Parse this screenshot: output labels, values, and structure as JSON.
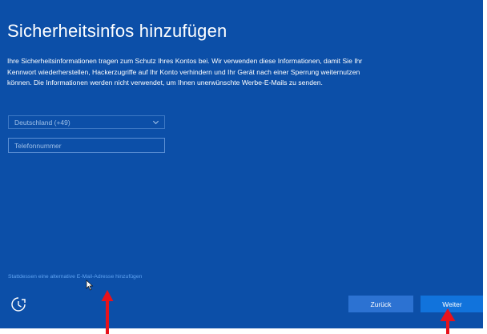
{
  "page": {
    "title": "Sicherheitsinfos hinzufügen",
    "description": "Ihre Sicherheitsinformationen tragen zum Schutz Ihres Kontos bei. Wir verwenden diese Informationen, damit Sie Ihr Kennwort wiederherstellen, Hackerzugriffe auf Ihr Konto verhindern und Ihr Gerät nach einer Sperrung weiternutzen können. Die Informationen werden nicht verwendet, um Ihnen unerwünschte Werbe-E-Mails zu senden."
  },
  "form": {
    "country_select": {
      "value": "Deutschland (+49)",
      "icon": "chevron-down-icon"
    },
    "phone_field": {
      "value": "",
      "placeholder": "Telefonnummer"
    },
    "alt_email_link": "Stattdessen eine alternative E-Mail-Adresse hinzufügen"
  },
  "footer": {
    "accessibility_icon": "ease-of-access-icon",
    "back_label": "Zurück",
    "next_label": "Weiter"
  },
  "annotations": {
    "arrow_color": "#e8121b",
    "arrow_icon": "red-arrow-up-icon",
    "cursor_icon": "mouse-pointer-icon"
  },
  "colors": {
    "background": "#0c4fa8",
    "accent_button": "#1173dc",
    "link": "#5fa3f2"
  }
}
